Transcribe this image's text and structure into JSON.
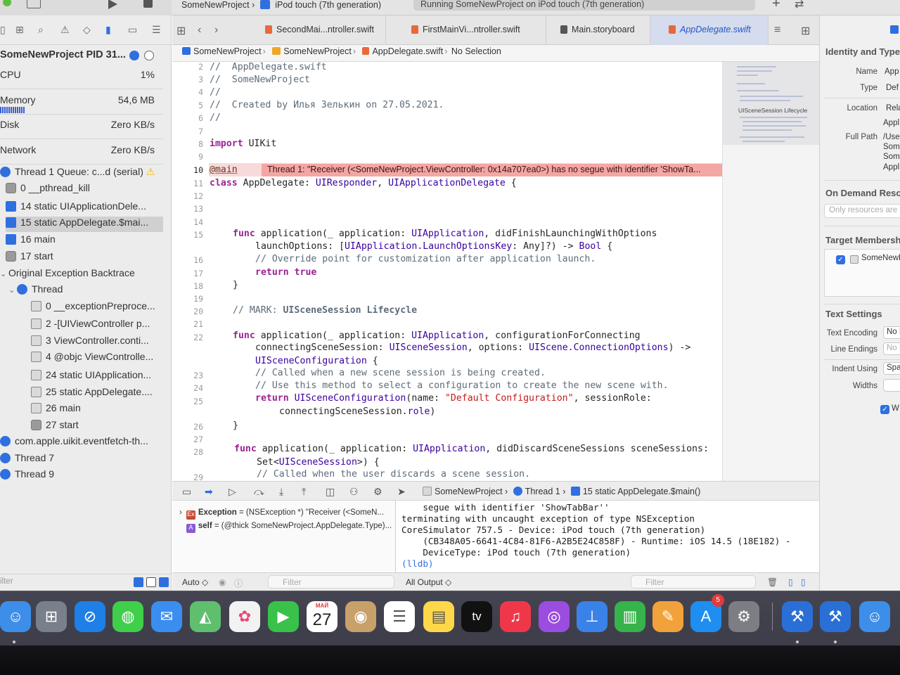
{
  "titlebar": {
    "scheme": "SomeNewProject",
    "device": "iPod touch (7th generation)",
    "status": "Running SomeNewProject on iPod touch (7th generation)"
  },
  "navigator": {
    "process": "SomeNewProject PID 31...",
    "gauges": [
      {
        "label": "CPU",
        "value": "1%"
      },
      {
        "label": "Memory",
        "value": "54,6 MB"
      },
      {
        "label": "Disk",
        "value": "Zero KB/s"
      },
      {
        "label": "Network",
        "value": "Zero KB/s"
      }
    ],
    "threads": [
      {
        "label": "Thread 1 Queue: c...d (serial)",
        "icon": "round",
        "warn": "⚠"
      },
      {
        "label": "0 __pthread_kill",
        "icon": "gear"
      },
      {
        "label": "14 static UIApplicationDele...",
        "icon": "blue"
      },
      {
        "label": "15 static AppDelegate.$mai...",
        "icon": "blue"
      },
      {
        "label": "16 main",
        "icon": "blue"
      },
      {
        "label": "17 start",
        "icon": "gear"
      },
      {
        "label": "Original Exception Backtrace",
        "icon": "none"
      },
      {
        "label": "Thread",
        "icon": "round"
      },
      {
        "label": "0 __exceptionPreproce...",
        "icon": "plain"
      },
      {
        "label": "2 -[UIViewController p...",
        "icon": "plain"
      },
      {
        "label": "3 ViewController.conti...",
        "icon": "plain"
      },
      {
        "label": "4 @objc ViewControlle...",
        "icon": "plain"
      },
      {
        "label": "24 static UIApplication...",
        "icon": "plain"
      },
      {
        "label": "25 static AppDelegate....",
        "icon": "plain"
      },
      {
        "label": "26 main",
        "icon": "plain"
      },
      {
        "label": "27 start",
        "icon": "gear"
      },
      {
        "label": "com.apple.uikit.eventfetch-th...",
        "icon": "round"
      },
      {
        "label": "Thread 7",
        "icon": "round"
      },
      {
        "label": "Thread 9",
        "icon": "round"
      }
    ],
    "filter_placeholder": "ilter"
  },
  "tabs": [
    {
      "label": "SecondMai...ntroller.swift"
    },
    {
      "label": "FirstMainVi...ntroller.swift"
    },
    {
      "label": "Main.storyboard"
    },
    {
      "label": "AppDelegate.swift"
    }
  ],
  "jumpbar": {
    "project": "SomeNewProject",
    "group": "SomeNewProject",
    "file": "AppDelegate.swift",
    "selection": "No Selection"
  },
  "editor": {
    "line_numbers": [
      "2",
      "3",
      "4",
      "5",
      "6",
      "7",
      "8",
      "9",
      "10",
      "11",
      "12",
      "13",
      "14",
      "15",
      "",
      "16",
      "17",
      "18",
      "19",
      "20",
      "21",
      "22",
      "",
      "",
      "23",
      "24",
      "25",
      "",
      "26",
      "27",
      "28",
      "",
      "29"
    ],
    "error_banner": "Thread 1: \"Receiver (<SomeNewProject.ViewController: 0x14a707ea0>) has no segue with identifier 'ShowTa...",
    "minimap_label": "UISceneSession Lifecycle"
  },
  "code": {
    "l2": "//  AppDelegate.swift",
    "l3": "//  SomeNewProject",
    "l4": "//",
    "l5": "//  Created by Илья Зелькин on 27.05.2021.",
    "l6": "//",
    "l8_kw": "import",
    "l8_rest": " UIKit",
    "l10": "@main",
    "l11_kw": "class",
    "l11_rest": " AppDelegate: ",
    "l11_t1": "UIResponder",
    "l11_t2": "UIApplicationDelegate",
    "l15_kw": "func",
    "l15_fn": " application(_ application: ",
    "l15_t": "UIApplication",
    "l15_rest": ", didFinishLaunchingWithOptions",
    "l15b": "launchOptions: [",
    "l15b_t": "UIApplication.LaunchOptionsKey",
    "l15b_rest": ": Any]?) -> ",
    "l15b_t2": "Bool",
    "l16": "// Override point for customization after application launch.",
    "l17_kw": "return",
    "l17_rest": " true",
    "l20_c": "// MARK: ",
    "l20_m": "UISceneSession Lifecycle",
    "l22_kw": "func",
    "l22_fn": " application(_ application: ",
    "l22_t": "UIApplication",
    "l22_rest": ", configurationForConnecting",
    "l22b": "connectingSceneSession: ",
    "l22b_t": "UISceneSession",
    "l22b_mid": ", options: ",
    "l22b_t2": "UIScene.ConnectionOptions",
    "l22b_rest": ") ->",
    "l22c": "UISceneConfiguration",
    "l23": "// Called when a new scene session is being created.",
    "l24": "// Use this method to select a configuration to create the new scene with.",
    "l25_kw": "return",
    "l25_t": " UISceneConfiguration",
    "l25_mid": "(name: ",
    "l25_s": "\"Default Configuration\"",
    "l25_rest": ", sessionRole:",
    "l25b": "connectingSceneSession.",
    "l25b_p": "role",
    "l28_kw": "func",
    "l28_fn": " application(_ application: ",
    "l28_t": "UIApplication",
    "l28_rest": ", didDiscardSceneSessions sceneSessions:",
    "l28b": "Set<",
    "l28b_t": "UISceneSession",
    "l28b_rest": ">) {",
    "l29": "// Called when the user discards a scene session."
  },
  "debugbar": {
    "crumb_project": "SomeNewProject",
    "crumb_thread": "Thread 1",
    "crumb_frame": "15 static AppDelegate.$main()"
  },
  "variables": [
    {
      "badge": "Ex",
      "name": "Exception",
      "value": " = (NSException *) \"Receiver (<SomeN..."
    },
    {
      "badge": "A",
      "name": "self",
      "value": " = (@thick SomeNewProject.AppDelegate.Type)..."
    }
  ],
  "console": [
    "    segue with identifier 'ShowTabBar''",
    "terminating with uncaught exception of type NSException",
    "CoreSimulator 757.5 - Device: iPod touch (7th generation)",
    "    (CB348A05-6641-4C84-81F6-A2B5E24C858F) - Runtime: iOS 14.5 (18E182) -",
    "    DeviceType: iPod touch (7th generation)",
    "(lldb)"
  ],
  "bottom": {
    "auto": "Auto ◇",
    "filter1": "Filter",
    "output": "All Output ◇",
    "filter2": "Filter"
  },
  "inspector": {
    "identity_header": "Identity and Type",
    "name_label": "Name",
    "name_value": "App",
    "type_label": "Type",
    "type_value": "Def",
    "location_label": "Location",
    "location_value": "Rela",
    "location_sub": "Appl",
    "fullpath_label": "Full Path",
    "fullpath_lines": [
      "/Use",
      "Som",
      "Som",
      "Appl"
    ],
    "ondemand_header": "On Demand Reso",
    "ondemand_placeholder": "Only resources are",
    "target_header": "Target Membersh",
    "target_item": "SomeNewP",
    "text_header": "Text Settings",
    "encoding_label": "Text Encoding",
    "encoding_value": "No E",
    "endings_label": "Line Endings",
    "endings_value": "No E",
    "indent_label": "Indent Using",
    "indent_value": "Spa",
    "widths_label": "Widths",
    "wrap_label": "W"
  },
  "dock": {
    "calendar_month": "МАЙ",
    "calendar_day": "27",
    "tv_label": "tv",
    "appstore_badge": "5",
    "colors": {
      "finder": "#3d8ee8",
      "launchpad": "#7a7f8c",
      "safari": "#1e7fe6",
      "messages": "#3fcf4a",
      "mail": "#3a8ef0",
      "maps": "#5fbf6f",
      "photos": "#f2f2f2",
      "facetime": "#39c24a",
      "calendar": "#ffffff",
      "contacts": "#c8a06a",
      "reminders": "#ffffff",
      "notes": "#ffd84a",
      "appletv": "#111111",
      "music": "#f0374a",
      "podcasts": "#9b4de0",
      "keynote": "#3b82e8",
      "numbers": "#36b34a",
      "pages": "#f2a23a",
      "appstore": "#1e8ef0",
      "settings": "#7d7d84",
      "xcode": "#2a6fd6",
      "xcode2": "#2a6fd6",
      "finder2": "#3d8ee8"
    }
  }
}
